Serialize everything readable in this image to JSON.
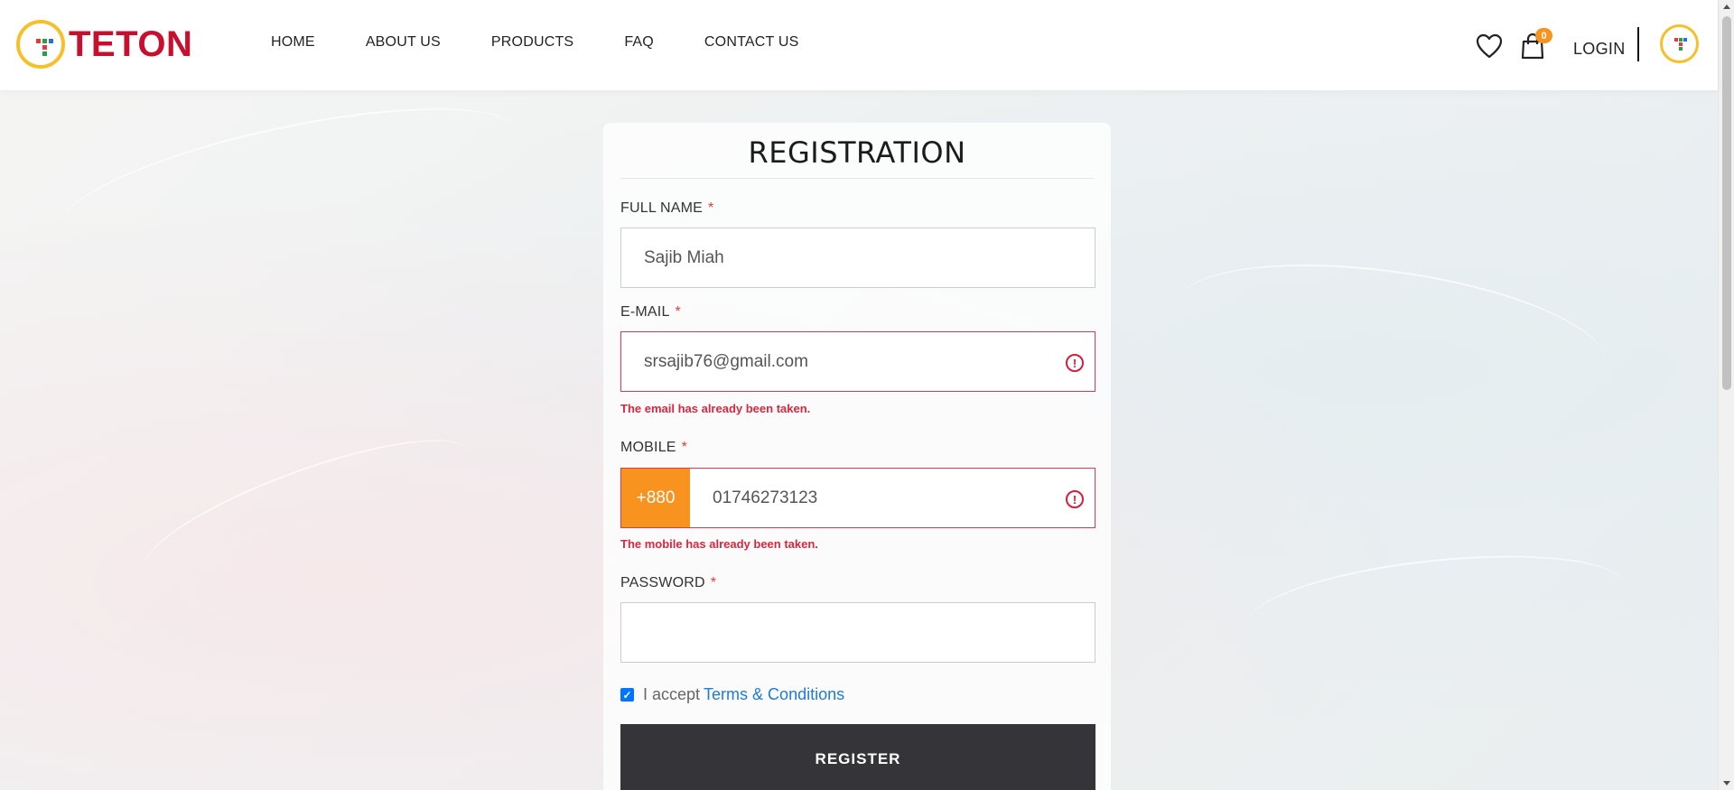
{
  "brand": {
    "name": "TETON",
    "colors": {
      "red": "#c8102e",
      "yellow": "#f5c02a",
      "orange": "#f7931e"
    }
  },
  "nav": {
    "items": [
      {
        "label": "HOME"
      },
      {
        "label": "ABOUT US"
      },
      {
        "label": "PRODUCTS"
      },
      {
        "label": "FAQ"
      },
      {
        "label": "CONTACT US"
      }
    ]
  },
  "header_tools": {
    "wishlist_icon": "heart-icon",
    "cart_icon": "shopping-bag-icon",
    "cart_count": "0",
    "login_label": "LOGIN"
  },
  "form": {
    "title": "REGISTRATION",
    "full_name": {
      "label": "FULL NAME",
      "required": "*",
      "value": "Sajib Miah"
    },
    "email": {
      "label": "E-MAIL",
      "required": "*",
      "value": "srsajib76@gmail.com",
      "error": "The email has already been taken."
    },
    "mobile": {
      "label": "MOBILE",
      "required": "*",
      "prefix": "+880",
      "value": "01746273123",
      "error": "The mobile has already been taken."
    },
    "password": {
      "label": "PASSWORD",
      "required": "*",
      "value": ""
    },
    "terms": {
      "checked": true,
      "text": "I accept",
      "link": "Terms & Conditions"
    },
    "submit_label": "REGISTER"
  }
}
